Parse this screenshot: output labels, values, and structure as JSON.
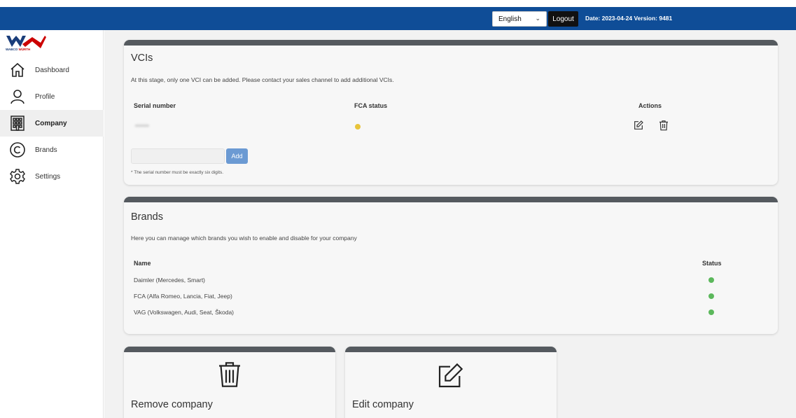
{
  "header": {
    "language": "English",
    "logout_label": "Logout",
    "meta": "Date: 2023-04-24  Version: 9481"
  },
  "logo": {
    "brand_left": "WABCO",
    "brand_right": "WÜRTH",
    "colors": [
      "#1a3d7a",
      "#cc0000"
    ]
  },
  "sidebar": {
    "items": [
      {
        "label": "Dashboard",
        "icon": "home-icon"
      },
      {
        "label": "Profile",
        "icon": "user-icon"
      },
      {
        "label": "Company",
        "icon": "building-icon"
      },
      {
        "label": "Brands",
        "icon": "copyright-icon"
      },
      {
        "label": "Settings",
        "icon": "gear-icon"
      }
    ],
    "active": "Company"
  },
  "vcis": {
    "title": "VCIs",
    "description": "At this stage, only one VCI can be added. Please contact your sales channel to add additional VCIs.",
    "columns": {
      "serial": "Serial number",
      "fca": "FCA status",
      "actions": "Actions"
    },
    "rows": [
      {
        "serial": "******",
        "fca_status_color": "#e8c43a"
      }
    ],
    "add_label": "Add",
    "input_placeholder": "",
    "hint": "* The serial number must be exactly six digits."
  },
  "brands": {
    "title": "Brands",
    "description": "Here you can manage which brands you wish to enable and disable for your company",
    "columns": {
      "name": "Name",
      "status": "Status"
    },
    "rows": [
      {
        "name": "Daimler (Mercedes, Smart)",
        "status_color": "#5cb85c"
      },
      {
        "name": "FCA (Alfa Romeo, Lancia, Fiat, Jeep)",
        "status_color": "#5cb85c"
      },
      {
        "name": "VAG (Volkswagen, Audi, Seat, Škoda)",
        "status_color": "#5cb85c"
      }
    ]
  },
  "remove_company": {
    "title": "Remove company",
    "icon": "trash-icon"
  },
  "edit_company": {
    "title": "Edit company",
    "icon": "edit-icon"
  },
  "colors": {
    "header_bg": "#0f4d97",
    "card_bar": "#555a5f",
    "add_button": "#6b9ad3",
    "status_green": "#5cb85c",
    "status_yellow": "#e8c43a"
  }
}
